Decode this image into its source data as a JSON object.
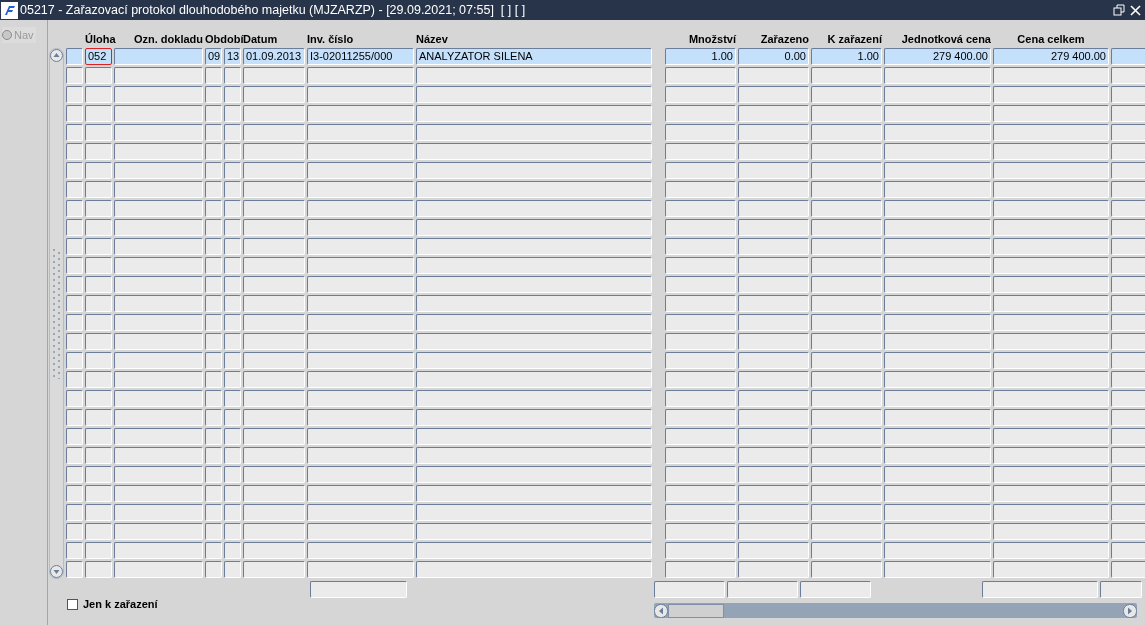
{
  "window": {
    "title": "05217 - Zařazovací protokol dlouhodobého majetku (MJZARZP) - [29.09.2021; 07:55]  [ ] [ ]"
  },
  "nav": {
    "label": "Nav",
    "selected": false
  },
  "columns": [
    "Úloha",
    "Ozn. dokladu",
    "Období",
    "Datum",
    "Inv. číslo",
    "Název",
    "Množství",
    "Zařazeno",
    "K zařazení",
    "Jednotková cena",
    "Cena celkem"
  ],
  "rows": [
    {
      "selected": true,
      "cells": [
        {
          "text": "052",
          "focused": true
        },
        null,
        {
          "text": "09",
          "focused": false
        },
        {
          "text": "13",
          "focused": false
        },
        {
          "text": "01.09.2013",
          "focused": false
        },
        {
          "text": "I3-02011255/000",
          "focused": false
        },
        {
          "text": "ANALYZATOR SILENA",
          "focused": false
        },
        {
          "text": "1.00",
          "focused": false
        },
        {
          "text": "0.00",
          "focused": false
        },
        {
          "text": "1.00",
          "focused": false
        },
        {
          "text": "279 400.00",
          "focused": false
        },
        {
          "text": "279 400.00",
          "focused": false
        }
      ]
    }
  ],
  "filter": {
    "label": "Jen k zařazení",
    "checked": false
  }
}
